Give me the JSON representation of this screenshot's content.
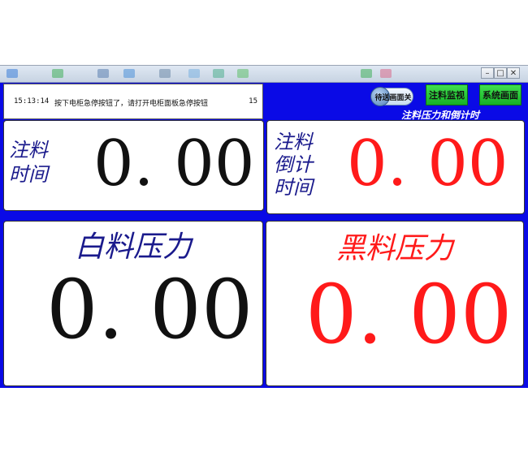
{
  "window": {
    "buttons": {
      "minimize": "–",
      "maximize": "□",
      "close": "✕"
    }
  },
  "message_bar": {
    "time": "15:13:14",
    "text": "按下电柜急停按钮了，请打开电柜面板急停按钮",
    "count": "15"
  },
  "header": {
    "toggle_label": "待送画面关",
    "inject_monitor_button": "注料监视",
    "system_screen_button": "系统画面",
    "section_title": "注料压力和倒计时"
  },
  "panels": {
    "inject_time": {
      "label_line1": "注料",
      "label_line2": "时间",
      "value": "0. 00"
    },
    "countdown": {
      "label_line1": "注料",
      "label_line2": "倒计",
      "label_line3": "时间",
      "value": "0. 00"
    },
    "white_pressure": {
      "label": "白料压力",
      "value": "0. 00"
    },
    "black_pressure": {
      "label": "黑料压力",
      "value": "0. 00"
    }
  },
  "colors": {
    "background_blue": "#0a0ae6",
    "label_navy": "#1a1a8c",
    "value_black": "#111111",
    "value_red": "#ff1a1a",
    "button_green": "#22c634"
  }
}
